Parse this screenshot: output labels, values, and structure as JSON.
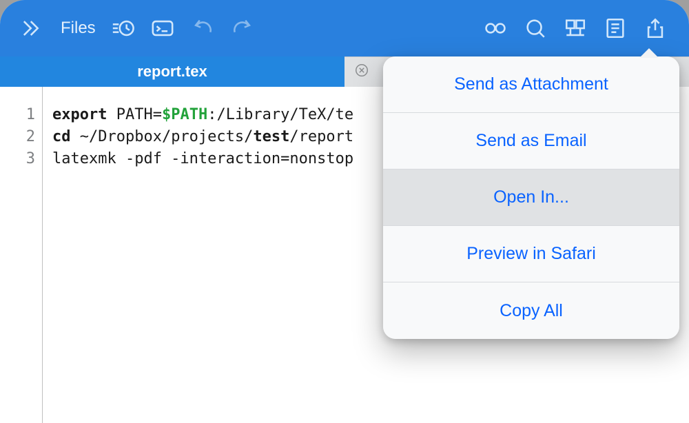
{
  "toolbar": {
    "files_label": "Files"
  },
  "tabs": {
    "active_filename": "report.tex"
  },
  "code": {
    "line_numbers": [
      "1",
      "2",
      "3"
    ],
    "line1": {
      "kw": "export",
      "assign": " PATH=",
      "env": "$PATH",
      "rest": ":/Library/TeX/te"
    },
    "line2": {
      "kw": "cd",
      "path_a": " ~/Dropbox/projects/",
      "seg": "test",
      "path_b": "/report"
    },
    "line3": {
      "text": "latexmk -pdf -interaction=nonstop"
    }
  },
  "popover": {
    "items": [
      "Send as Attachment",
      "Send as Email",
      "Open In...",
      "Preview in Safari",
      "Copy All"
    ],
    "highlighted_index": 2
  }
}
